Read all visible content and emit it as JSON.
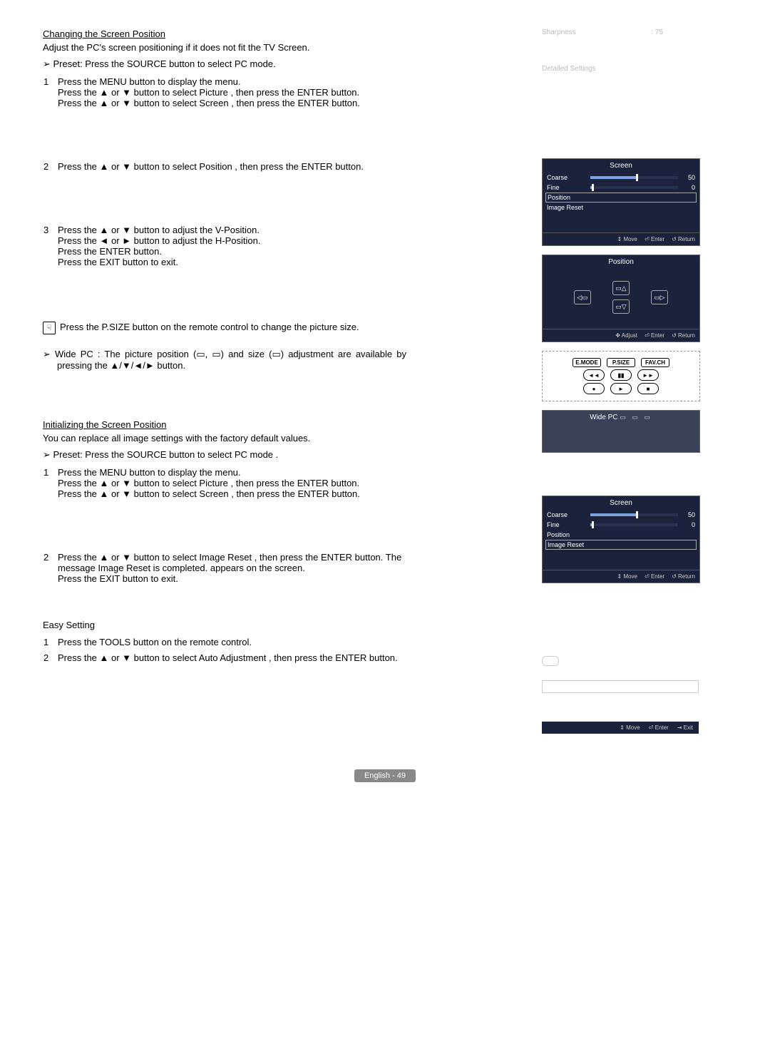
{
  "top_right": {
    "sharpness_label": "Sharpness",
    "sharpness_value": ": 75",
    "detailed": "Detailed Settings"
  },
  "section_change": {
    "heading": "Changing the Screen Position",
    "desc": "Adjust the PC's screen positioning if it does not fit the TV Screen.",
    "preset": "Preset: Press the SOURCE button to select PC mode.",
    "step1": "Press the MENU button to display the menu.\nPress the ▲ or ▼ button to select Picture , then press the ENTER button.\nPress the ▲ or ▼ button to select Screen , then press the ENTER button.",
    "step2": "Press the ▲ or ▼ button to select Position , then press the ENTER button.",
    "step3": "Press the ▲ or ▼ button to adjust the V-Position.\nPress the ◄ or ► button to adjust the H-Position.\nPress the ENTER button.\nPress the EXIT button to exit.",
    "hint_icon": "☟",
    "hint_psize": "Press the P.SIZE button on the remote control to change the picture size.",
    "hint_widepc": "Wide PC : The picture position (▭, ▭) and size (▭) adjustment are available by pressing the ▲/▼/◄/► button."
  },
  "osd_screen": {
    "title": "Screen",
    "rows": [
      {
        "label": "Coarse",
        "val": "50",
        "fill": 52
      },
      {
        "label": "Fine",
        "val": "0",
        "fill": 2
      }
    ],
    "position": "Position",
    "image_reset": "Image Reset",
    "foot_move": "⇕ Move",
    "foot_enter": "⏎ Enter",
    "foot_return": "↺ Return"
  },
  "osd_position": {
    "title": "Position",
    "foot_adjust": "✥ Adjust",
    "foot_enter": "⏎ Enter",
    "foot_return": "↺ Return"
  },
  "remote": {
    "emode": "E.MODE",
    "psize": "P.SIZE",
    "favch": "FAV.CH",
    "rew": "◄◄",
    "pause": "▮▮",
    "ff": "►►",
    "rec": "●",
    "play": "►",
    "stop": "■"
  },
  "widepc_label": "Wide PC",
  "section_init": {
    "heading": "Initializing the Screen Position",
    "desc": "You can replace all image settings with the factory default values.",
    "preset": "Preset: Press the SOURCE button to select PC mode .",
    "step1": "Press the MENU button to display the menu.\nPress the ▲ or ▼ button to select Picture , then press the ENTER button.\nPress the ▲ or ▼ button to select Screen , then press the ENTER button.",
    "step2": "Press the ▲ or ▼ button to select Image Reset , then press the ENTER button. The message Image Reset is completed.   appears on the screen.\nPress the EXIT button to exit."
  },
  "easy": {
    "heading": "Easy Setting",
    "step1": "Press the TOOLS button on the remote control.",
    "step2": "Press the ▲ or ▼ button to select Auto Adjustment  , then press the ENTER button."
  },
  "bottom": {
    "move": "⇕ Move",
    "enter": "⏎ Enter",
    "exit": "⇥ Exit"
  },
  "page": "English - 49"
}
